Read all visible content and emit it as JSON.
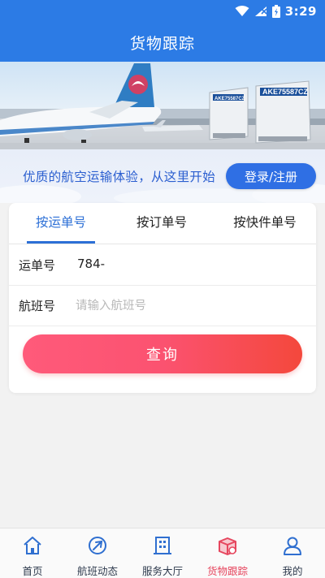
{
  "status_bar": {
    "time": "3:29",
    "icons": [
      "wifi-icon",
      "signal-icon",
      "battery-icon"
    ]
  },
  "header": {
    "title": "货物跟踪"
  },
  "banner": {
    "container_labels": [
      "AKE75587CZ",
      "AKE75587CZ"
    ]
  },
  "promo": {
    "text": "优质的航空运输体验，从这里开始",
    "login_label": "登录/注册"
  },
  "tabs": [
    {
      "label": "按运单号",
      "active": true
    },
    {
      "label": "按订单号",
      "active": false
    },
    {
      "label": "按快件单号",
      "active": false
    }
  ],
  "form": {
    "waybill_label": "运单号",
    "waybill_value": "784-",
    "flight_label": "航班号",
    "flight_placeholder": "请输入航班号",
    "query_label": "查询"
  },
  "bottom_nav": {
    "items": [
      {
        "label": "首页",
        "icon": "home-icon"
      },
      {
        "label": "航班动态",
        "icon": "plane-icon"
      },
      {
        "label": "服务大厅",
        "icon": "building-icon"
      },
      {
        "label": "货物跟踪",
        "icon": "cargo-box-icon",
        "active": true
      },
      {
        "label": "我的",
        "icon": "user-icon"
      }
    ]
  },
  "colors": {
    "primary": "#2c7be5",
    "accent": "#e6465e",
    "query_start": "#ff5a7a",
    "query_end": "#f4483c"
  }
}
